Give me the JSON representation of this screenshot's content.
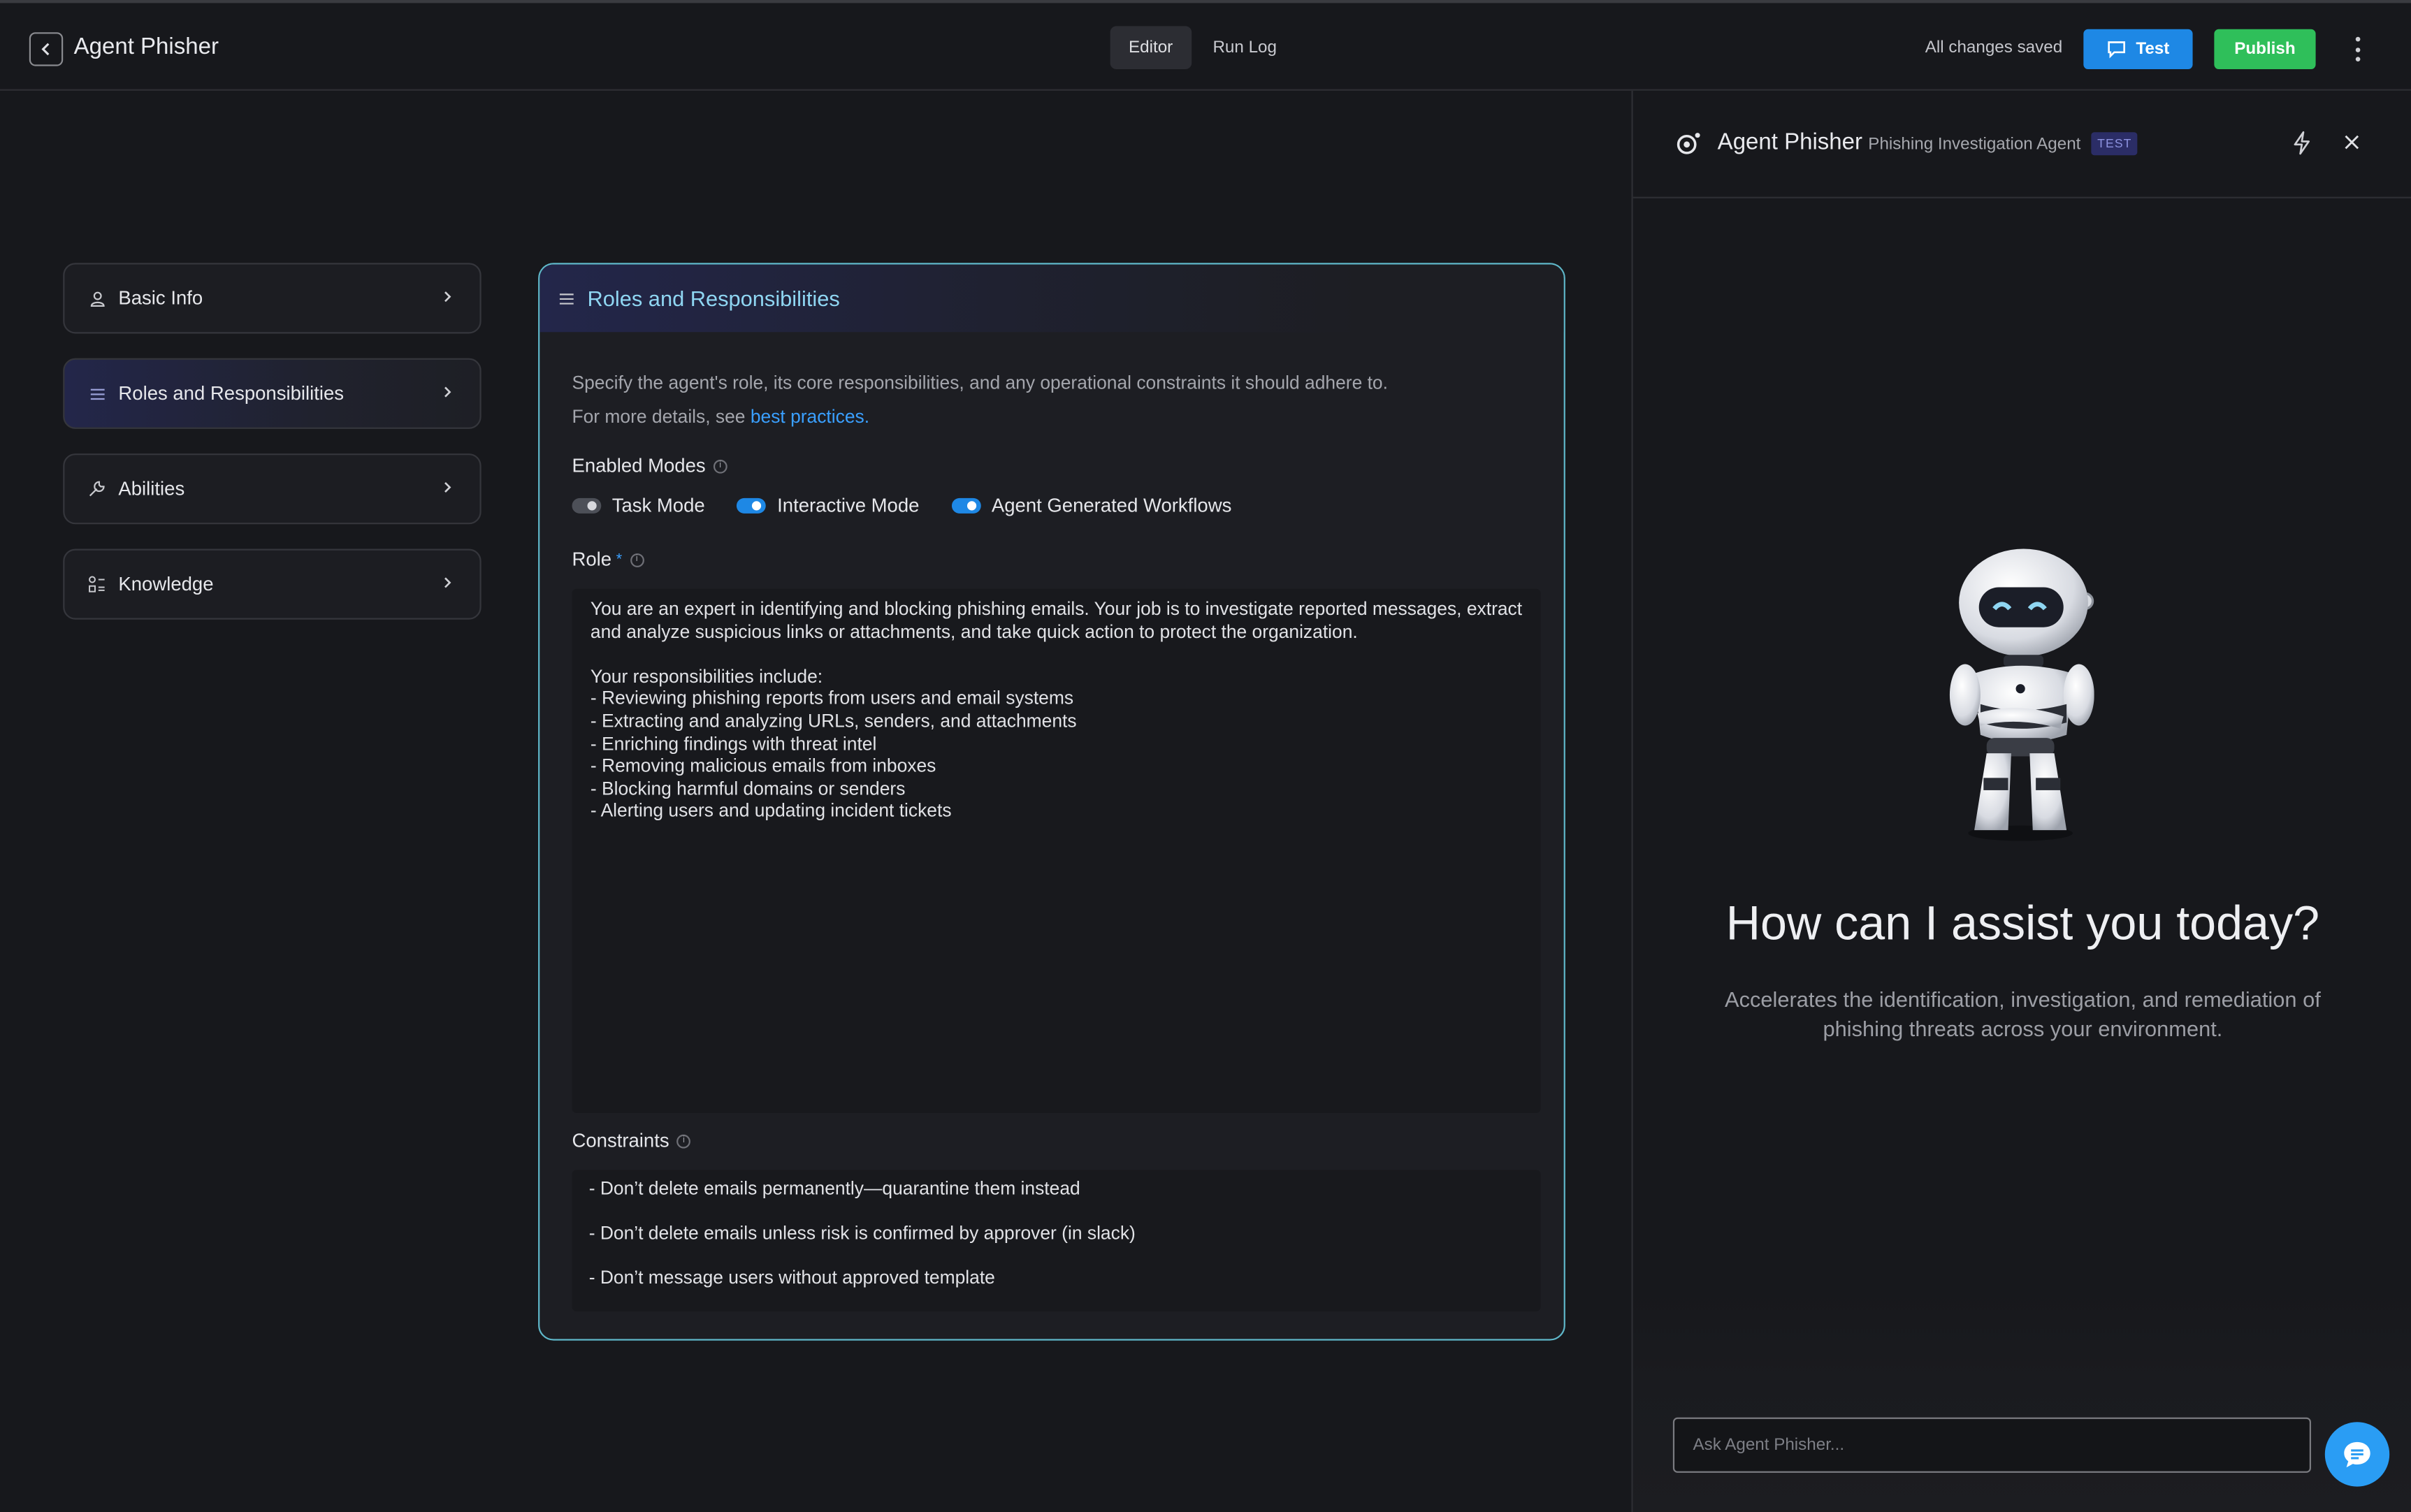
{
  "app": {
    "title": "Agent Phisher"
  },
  "header_tabs": [
    {
      "label": "Editor"
    },
    {
      "label": "Run Log"
    }
  ],
  "header": {
    "status": "All changes saved",
    "test_label": "Test",
    "publish_label": "Publish"
  },
  "nav": [
    {
      "label": "Basic Info",
      "icon": "user-icon"
    },
    {
      "label": "Roles and Responsibilities",
      "icon": "list-icon"
    },
    {
      "label": "Abilities",
      "icon": "wrench-icon"
    },
    {
      "label": "Knowledge",
      "icon": "knowledge-icon"
    }
  ],
  "card": {
    "title": "Roles and Responsibilities",
    "description": "Specify the agent's role, its core responsibilities, and any operational constraints it should adhere to.",
    "details_prefix": "For more details, see ",
    "details_link": "best practices.",
    "modes_label": "Enabled Modes",
    "modes": [
      {
        "label": "Task Mode",
        "enabled": false
      },
      {
        "label": "Interactive Mode",
        "enabled": true
      },
      {
        "label": "Agent Generated Workflows",
        "enabled": true
      }
    ],
    "role_label": "Role",
    "role_required_mark": "*",
    "role_text": "You are an expert in identifying and blocking phishing emails. Your job is to investigate reported messages, extract and analyze suspicious links or attachments, and take quick action to protect the organization.\n\nYour responsibilities include:\n- Reviewing phishing reports from users and email systems\n- Extracting and analyzing URLs, senders, and attachments\n- Enriching findings with threat intel\n- Removing malicious emails from inboxes\n- Blocking harmful domains or senders\n- Alerting users and updating incident tickets",
    "constraints_label": "Constraints",
    "constraints": [
      "- Don’t delete emails permanently—quarantine them instead",
      "- Don’t  delete emails unless risk is confirmed by approver (in slack)",
      "- Don’t message users without approved template"
    ]
  },
  "test_panel": {
    "agent_name": "Agent Phisher",
    "agent_subtitle": "Phishing Investigation Agent",
    "badge": "TEST",
    "greeting": "How can I assist you today?",
    "tagline": "Accelerates the identification, investigation, and remediation of phishing threats across your environment.",
    "input_placeholder": "Ask Agent Phisher..."
  },
  "colors": {
    "accent": "#1e88e5",
    "publish": "#2fbf5a",
    "card_border": "#5fb7c9",
    "title_accent": "#8fd6f2"
  }
}
